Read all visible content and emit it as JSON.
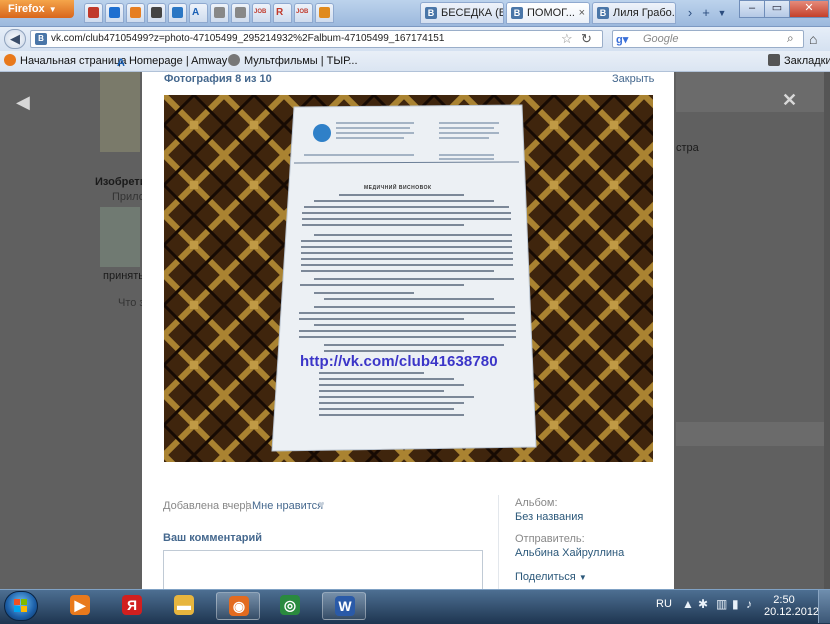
{
  "browser": {
    "menu_button": "Firefox",
    "tabs": [
      {
        "label": "БЕСЕДКА (Б...",
        "active": false
      },
      {
        "label": "ПОМОГ...",
        "active": true
      },
      {
        "label": "Лиля Грабо...",
        "active": false
      }
    ],
    "pinned_tabs": [
      {
        "glyph": "",
        "color": "#c0392b"
      },
      {
        "glyph": "",
        "color": "#1e6fd0"
      },
      {
        "glyph": "",
        "color": "#e67e22"
      },
      {
        "glyph": "",
        "color": "#444444"
      },
      {
        "glyph": "",
        "color": "#2b77c4"
      },
      {
        "glyph": "A",
        "color": "#1a5fb4"
      },
      {
        "glyph": "",
        "color": "#888888"
      },
      {
        "glyph": "",
        "color": "#888888"
      },
      {
        "glyph": "JOB",
        "color": "#c0392b"
      },
      {
        "glyph": "R",
        "color": "#c0392b"
      },
      {
        "glyph": "JOB",
        "color": "#c0392b"
      },
      {
        "glyph": "",
        "color": "#e08a1e"
      }
    ],
    "url": "vk.com/club47105499?z=photo-47105499_295214932%2Falbum-47105499_167174151",
    "search_placeholder": "Google",
    "bookmarks": [
      "Начальная страница",
      "Homepage | Amway",
      "Мультфильмы | ТЫР..."
    ],
    "bookmarks_menu": "Закладки",
    "colors": {
      "accent": "#45688e",
      "link": "#2b587a"
    }
  },
  "background_page": {
    "snippets": [
      "Изобретите",
      "Прило",
      "принять",
      "Что з",
      "стра"
    ]
  },
  "photo_viewer": {
    "counter": "Фотография 8 из 10",
    "close_label": "Закрыть",
    "photo": {
      "document_title": "МЕДИЧНИЙ ВИСНОВОК",
      "watermark_url": "http://vk.com/club41638780"
    },
    "added": "Добавлена вчера",
    "separator": "|",
    "like_label": "Мне нравится",
    "comment_heading": "Ваш комментарий",
    "comment_value": "",
    "sidebar": {
      "album_label": "Альбом:",
      "album_value": "Без названия",
      "sender_label": "Отправитель:",
      "sender_value": "Альбина Хайруллина",
      "share_label": "Поделиться"
    }
  },
  "taskbar": {
    "apps": [
      {
        "name": "media-player",
        "color": "#e8791c",
        "glyph": "▶",
        "open": false
      },
      {
        "name": "yandex",
        "color": "#d11f1f",
        "glyph": "Я",
        "open": false
      },
      {
        "name": "explorer",
        "color": "#e7b53e",
        "glyph": "▬",
        "open": false
      },
      {
        "name": "firefox",
        "color": "#e36b1f",
        "glyph": "◉",
        "open": true
      },
      {
        "name": "chrome",
        "color": "#2a8a3e",
        "glyph": "◎",
        "open": false
      },
      {
        "name": "word",
        "color": "#2a5aa8",
        "glyph": "W",
        "open": true
      }
    ],
    "language": "RU",
    "time": "2:50",
    "date": "20.12.2012"
  }
}
